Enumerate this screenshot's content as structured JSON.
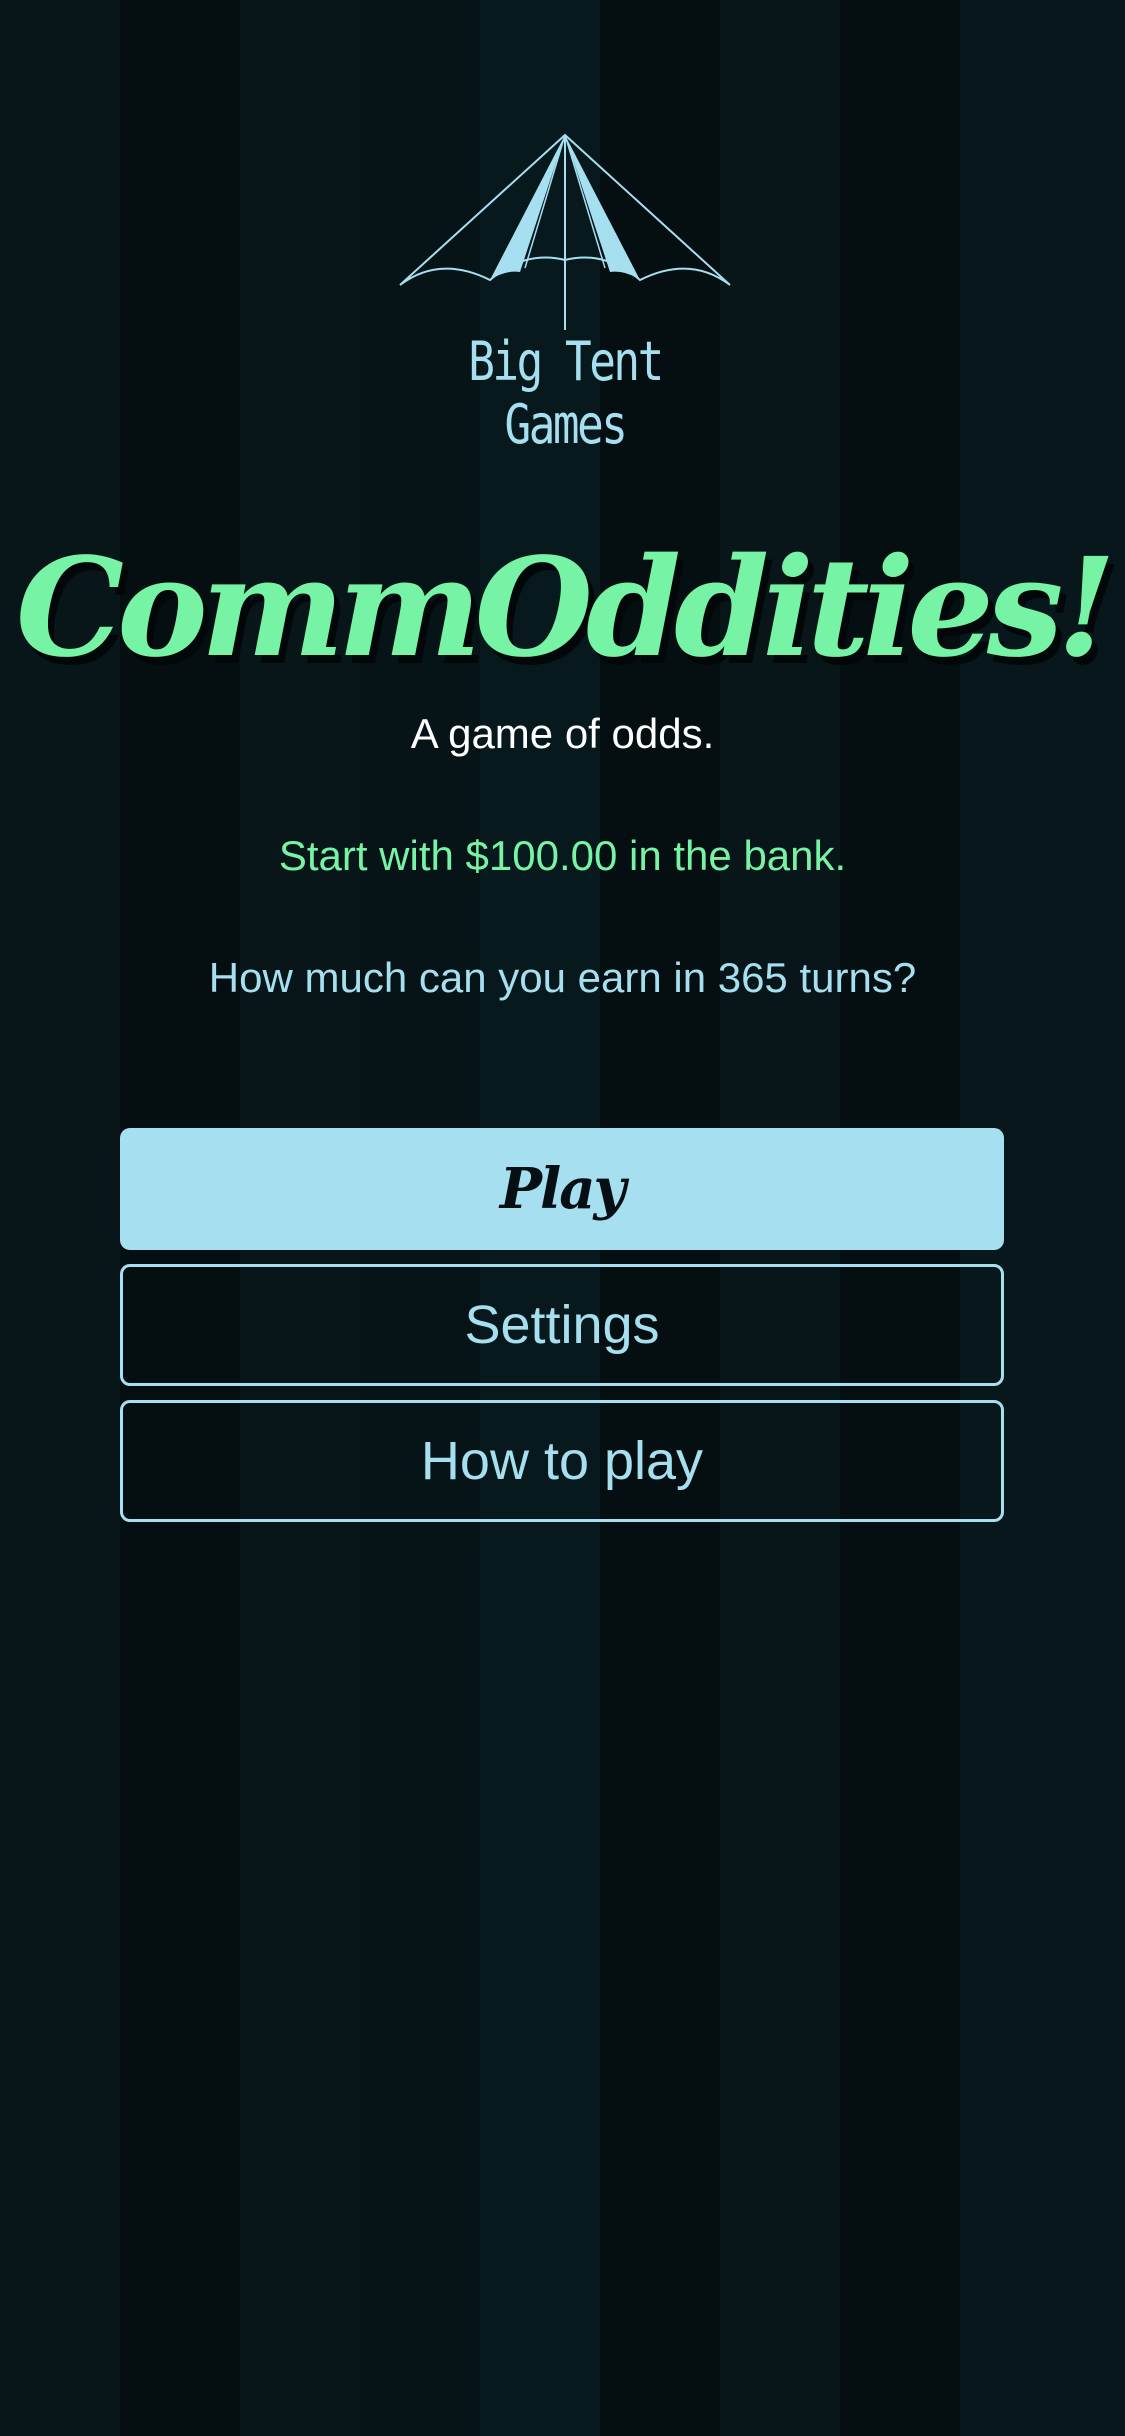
{
  "brand": {
    "logo_icon": "circus-tent-icon",
    "logo_text": "Big Tent Games"
  },
  "header": {
    "title": "CommOddities!",
    "subtitle": "A game of odds."
  },
  "intro": {
    "bank_line": "Start with $100.00 in the bank.",
    "question_line": "How much can you earn in 365 turns?"
  },
  "menu": {
    "play_label": "Play",
    "settings_label": "Settings",
    "how_to_play_label": "How to play"
  },
  "colors": {
    "background": "#07171b",
    "accent_green": "#76f3a4",
    "accent_blue": "#a5dff0",
    "text_white": "#ffffff"
  }
}
